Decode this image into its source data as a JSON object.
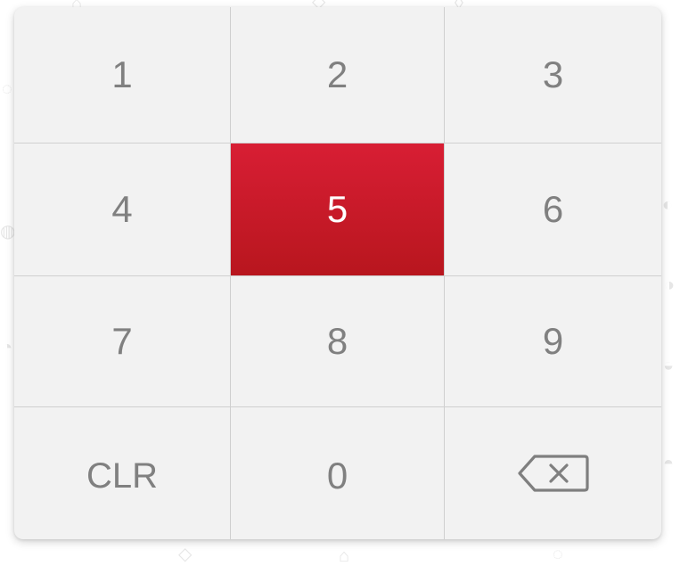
{
  "keypad": {
    "keys": [
      {
        "label": "1"
      },
      {
        "label": "2"
      },
      {
        "label": "3"
      },
      {
        "label": "4"
      },
      {
        "label": "5"
      },
      {
        "label": "6"
      },
      {
        "label": "7"
      },
      {
        "label": "8"
      },
      {
        "label": "9"
      },
      {
        "label": "CLR"
      },
      {
        "label": "0"
      },
      {
        "icon": "backspace-icon"
      }
    ],
    "active_key": "5",
    "colors": {
      "panel": "#f2f2f2",
      "text": "#808080",
      "active_top": "#d81e34",
      "active_bottom": "#b8161e",
      "active_text": "#ffffff",
      "divider": "#d0d0d0"
    }
  }
}
